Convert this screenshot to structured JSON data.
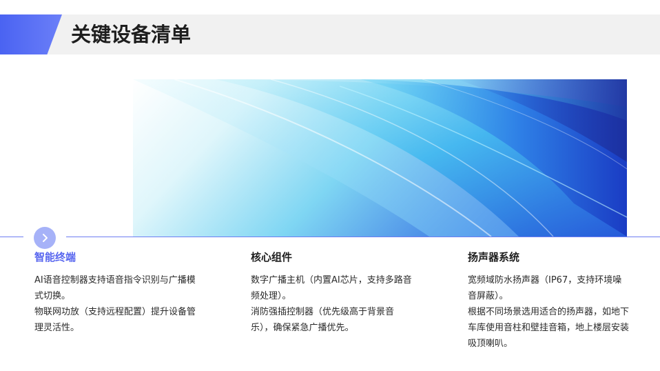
{
  "header": {
    "title": "关键设备清单"
  },
  "columns": [
    {
      "heading": "智能终端",
      "lines": [
        "AI语音控制器支持语音指令识别与广播模式切换。",
        "物联网功放（支持远程配置）提升设备管理灵活性。"
      ]
    },
    {
      "heading": "核心组件",
      "lines": [
        "数字广播主机（内置AI芯片，支持多路音频处理）。",
        "消防强插控制器（优先级高于背景音乐），确保紧急广播优先。"
      ]
    },
    {
      "heading": "扬声器系统",
      "lines": [
        "宽频域防水扬声器（IP67，支持环境噪音屏蔽）。",
        "根据不同场景选用适合的扬声器，如地下车库使用音柱和壁挂音箱，地上楼层安装吸顶喇叭。"
      ]
    }
  ],
  "icons": {
    "divider_marker": "chevron-right-icon",
    "banner": "abstract-blue-waves-image"
  },
  "colors": {
    "accent": "#4a63f2",
    "accent_light": "#a6b2f8",
    "heading_highlight": "#5866ef",
    "title_bar": "#f1f1f1"
  }
}
